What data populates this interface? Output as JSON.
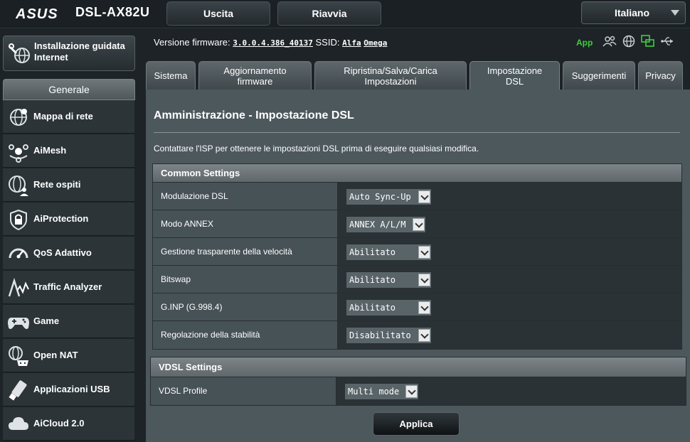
{
  "header": {
    "logo_text": "ASUS",
    "model": "DSL-AX82U",
    "logout_label": "Uscita",
    "reboot_label": "Riavvia",
    "language": "Italiano"
  },
  "sidebar": {
    "qis_label": "Installazione guidata Internet",
    "general_header": "Generale",
    "items": [
      {
        "label": "Mappa di rete",
        "icon": "network-map-icon"
      },
      {
        "label": "AiMesh",
        "icon": "aimesh-icon"
      },
      {
        "label": "Rete ospiti",
        "icon": "guest-network-icon"
      },
      {
        "label": "AiProtection",
        "icon": "shield-lock-icon"
      },
      {
        "label": "QoS Adattivo",
        "icon": "speedometer-icon"
      },
      {
        "label": "Traffic Analyzer",
        "icon": "traffic-analyzer-icon"
      },
      {
        "label": "Game",
        "icon": "gamepad-icon"
      },
      {
        "label": "Open NAT",
        "icon": "open-nat-icon"
      },
      {
        "label": "Applicazioni USB",
        "icon": "usb-icon"
      },
      {
        "label": "AiCloud 2.0",
        "icon": "cloud-icon"
      }
    ]
  },
  "info": {
    "firmware_label": "Versione firmware:",
    "firmware_value": "3.0.0.4.386_40137",
    "ssid_label": "SSID:",
    "ssid_1": "Alfa",
    "ssid_2": "Omega",
    "app_label": "App"
  },
  "tabs": [
    {
      "label": "Sistema",
      "active": false
    },
    {
      "label": "Aggiornamento firmware",
      "active": false
    },
    {
      "label": "Ripristina/Salva/Carica Impostazioni",
      "active": false
    },
    {
      "label": "Impostazione DSL",
      "active": true
    },
    {
      "label": "Suggerimenti",
      "active": false
    },
    {
      "label": "Privacy",
      "active": false
    }
  ],
  "main": {
    "title": "Amministrazione - Impostazione DSL",
    "description": "Contattare l'ISP per ottenere le impostazioni DSL prima di eseguire qualsiasi modifica.",
    "common": {
      "header": "Common Settings",
      "rows": [
        {
          "label": "Modulazione DSL",
          "value": "Auto Sync-Up"
        },
        {
          "label": "Modo ANNEX",
          "value": "ANNEX A/L/M"
        },
        {
          "label": "Gestione trasparente della velocità",
          "value": "Abilitato"
        },
        {
          "label": "Bitswap",
          "value": "Abilitato"
        },
        {
          "label": "G.INP (G.998.4)",
          "value": "Abilitato"
        },
        {
          "label": "Regolazione della stabilità",
          "value": "Disabilitato"
        }
      ]
    },
    "vdsl": {
      "header": "VDSL Settings",
      "rows": [
        {
          "label": "VDSL Profile",
          "value": "Multi mode"
        }
      ]
    },
    "apply_label": "Applica"
  },
  "colors": {
    "background": "#1d2327",
    "panel": "#4d585d",
    "app_green": "#3fce3f"
  }
}
